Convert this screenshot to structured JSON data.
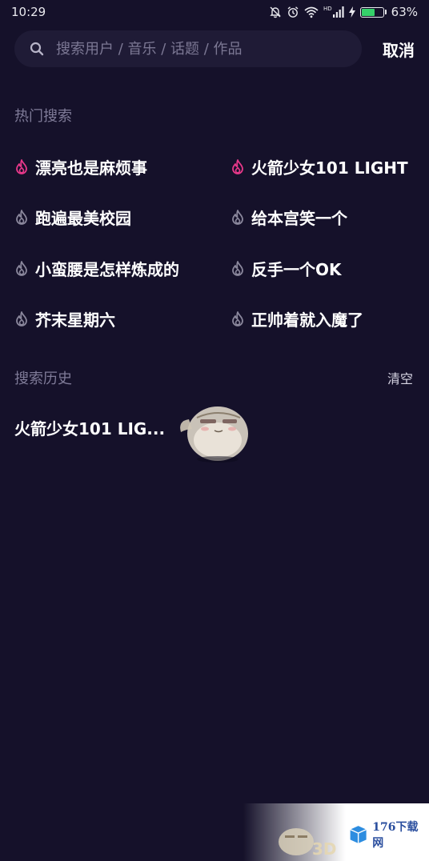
{
  "status_bar": {
    "time": "10:29",
    "network": "HD",
    "battery_percent": "63%",
    "battery_level": 0.63,
    "icons": [
      "mute-bell-icon",
      "alarm-icon",
      "wifi-icon",
      "signal-icon",
      "charging-icon",
      "battery-icon"
    ]
  },
  "search": {
    "placeholder": "搜索用户 / 音乐 / 话题 / 作品",
    "value": "",
    "cancel_label": "取消"
  },
  "hot_search": {
    "heading": "热门搜索",
    "items": [
      {
        "label": "漂亮也是麻烦事",
        "highlight": true
      },
      {
        "label": "火箭少女101 LIGHT",
        "highlight": true
      },
      {
        "label": "跑遍最美校园",
        "highlight": false
      },
      {
        "label": "给本宫笑一个",
        "highlight": false
      },
      {
        "label": "小蛮腰是怎样炼成的",
        "highlight": false
      },
      {
        "label": "反手一个OK",
        "highlight": false
      },
      {
        "label": "芥末星期六",
        "highlight": false
      },
      {
        "label": "正帅着就入魔了",
        "highlight": false
      }
    ]
  },
  "history": {
    "heading": "搜索历史",
    "clear_label": "清空",
    "items": [
      {
        "label": "火箭少女101 LIG..."
      }
    ]
  },
  "watermark": {
    "text": "176下载网"
  },
  "colors": {
    "background": "#15112a",
    "search_box": "#1f1b36",
    "heading": "#7f7b98",
    "flame_hot": "#e8388a",
    "flame_normal": "#8a879c",
    "battery_fill": "#35d06a"
  }
}
